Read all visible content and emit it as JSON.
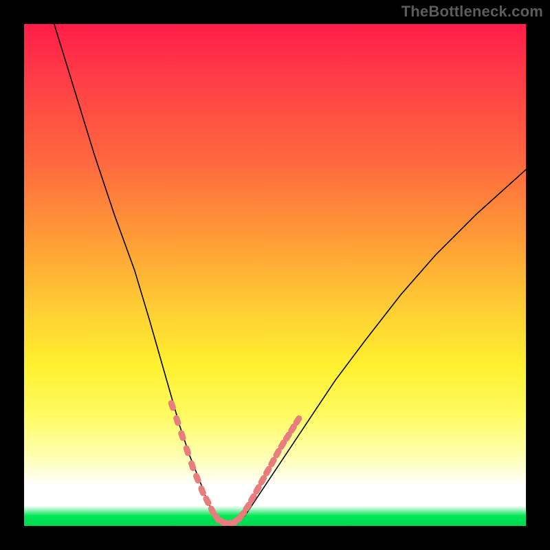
{
  "watermark": "TheBottleneck.com",
  "colors": {
    "frame": "#000000",
    "watermark": "#5c5c5c",
    "curve": "#000000",
    "marker": "#e77d7d",
    "green": "#00d74f"
  },
  "chart_data": {
    "type": "line",
    "title": "",
    "xlabel": "",
    "ylabel": "",
    "xlim": [
      0,
      100
    ],
    "ylim": [
      0,
      100
    ],
    "annotations": [],
    "series": [
      {
        "name": "bottleneck-curve",
        "x": [
          6,
          10,
          14,
          18,
          22,
          25,
          27,
          29,
          31,
          33,
          35,
          36.5,
          38,
          40,
          42,
          44,
          46,
          50,
          54,
          58,
          62,
          68,
          75,
          82,
          90,
          100
        ],
        "y": [
          100,
          87,
          74,
          62,
          51,
          41,
          34,
          27,
          20,
          14,
          9,
          5,
          2,
          0.5,
          0.5,
          2,
          5,
          11,
          17,
          23,
          29,
          37,
          46,
          54,
          62,
          71
        ]
      }
    ],
    "markers": {
      "name": "highlighted-range",
      "x": [
        29.5,
        30.5,
        31.5,
        32.5,
        33.5,
        34.5,
        35.5,
        36.5,
        37.5,
        38.5,
        39.5,
        40.5,
        41.5,
        42.5,
        43.5,
        44.5,
        45.5,
        46.5,
        47.5,
        48.5,
        49.5,
        50.5,
        51.5,
        52.5,
        53.5,
        54.5
      ],
      "y": [
        24,
        21,
        18,
        15,
        12,
        9.5,
        7,
        5,
        3,
        1.5,
        0.8,
        0.5,
        0.6,
        1.2,
        2.3,
        3.8,
        5.5,
        7.3,
        9.1,
        10.9,
        12.7,
        14.5,
        16.2,
        17.8,
        19.4,
        21
      ]
    }
  }
}
